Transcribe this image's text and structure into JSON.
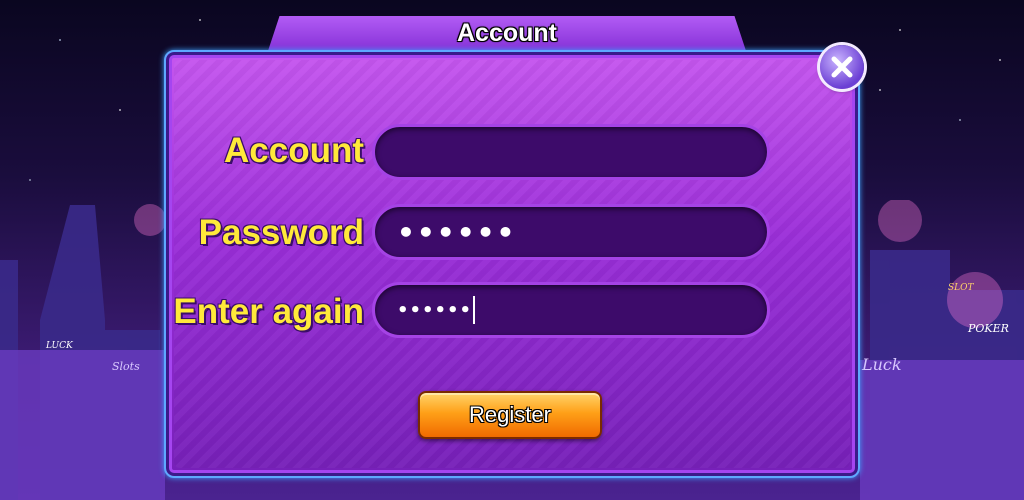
{
  "popup": {
    "title": "Account",
    "close_icon": "close-icon",
    "fields": [
      {
        "label": "Account",
        "value": ""
      },
      {
        "label": "Password",
        "value": "••••••"
      },
      {
        "label": "Enter again",
        "value": "••••••"
      }
    ],
    "register_label": "Register"
  },
  "background": {
    "signs": [
      "LUCK",
      "Slots",
      "Luck",
      "POKER",
      "SLOT"
    ]
  },
  "colors": {
    "panel": "#9a2ed8",
    "label": "#ffe93a",
    "button": "#ffa018",
    "border": "#5fa8ff"
  }
}
